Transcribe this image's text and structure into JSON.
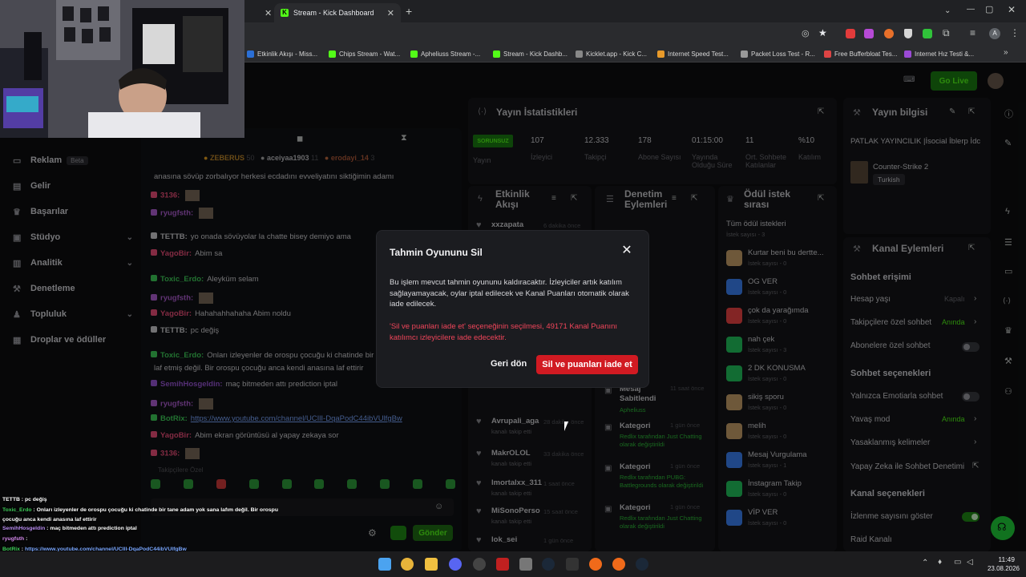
{
  "browser": {
    "active_tab": "Stream - Kick Dashboard",
    "new_tab_icon": "plus-icon",
    "bookmarks": [
      "Etkinlik Akışı - Miss...",
      "Chips Stream - Wat...",
      "Apheliuss Stream -...",
      "Stream - Kick Dashb...",
      "Kicklet.app - Kick C...",
      "Internet Speed Test...",
      "Packet Loss Test - R...",
      "Free Bufferbloat Tes...",
      "Internet Hız Testi &..."
    ]
  },
  "header": {
    "go_live": "Go Live"
  },
  "sidebar": {
    "items": [
      {
        "label": "Reklam",
        "badge": "Beta",
        "icon": "megaphone-icon"
      },
      {
        "label": "Gelir",
        "icon": "money-icon"
      },
      {
        "label": "Başarılar",
        "icon": "trophy-icon"
      },
      {
        "label": "Stüdyo",
        "icon": "studio-icon"
      },
      {
        "label": "Analitik",
        "icon": "chart-icon"
      },
      {
        "label": "Denetleme",
        "icon": "hammer-icon"
      },
      {
        "label": "Topluluk",
        "icon": "people-icon"
      },
      {
        "label": "Droplar ve ödüller",
        "icon": "gift-icon"
      }
    ]
  },
  "chat": {
    "top_users": [
      "ZEBERUS",
      "aceiyaa1903",
      "erodayi_14"
    ],
    "top_counts": [
      "50",
      "11",
      "3"
    ],
    "lines": [
      {
        "user": "",
        "text": "anasına sövüp zorbalıyor herkesi ecdadını evveliyatını siktiğimin adamı",
        "color": "#cfcfd3"
      },
      {
        "user": "3136:",
        "text": "",
        "color": "#ef4f7a"
      },
      {
        "user": "ryugfsth:",
        "text": "",
        "color": "#b15fd6"
      },
      {
        "user": "TETTB:",
        "text": "yo onada sövüyolar la chatte bisey demiyo ama",
        "color": "#cfcfd3"
      },
      {
        "user": "YagoBir:",
        "text": "Abim sa",
        "color": "#ef4f7a"
      },
      {
        "user": "Toxic_Erdo:",
        "text": "Aleyküm selam",
        "color": "#3fcf5a"
      },
      {
        "user": "ryugfsth:",
        "text": "",
        "color": "#b15fd6"
      },
      {
        "user": "YagoBir:",
        "text": "Hahahahhahaha Abim noldu",
        "color": "#ef4f7a"
      },
      {
        "user": "TETTB:",
        "text": "pc değiş",
        "color": "#cfcfd3"
      },
      {
        "user": "Toxic_Erdo:",
        "text": "Onları izleyenler de orospu çocuğu ki chatinde bir tane adam yok sana",
        "color": "#3fcf5a"
      },
      {
        "user": "",
        "text": "laf etmiş değil. Bir orospu çocuğu anca kendi anasına laf ettirir",
        "color": "#cfcfd3"
      },
      {
        "user": "SemihHosgeldin:",
        "text": "maç bitmeden attı prediction iptal",
        "color": "#9a56d8"
      },
      {
        "user": "ryugfsth:",
        "text": "",
        "color": "#b15fd6"
      },
      {
        "user": "BotRix:",
        "text": "https://www.youtube.com/channel/UCIlI-DqaPodC44ibVUlfgBw",
        "color": "#3fcf5a"
      },
      {
        "user": "YagoBir:",
        "text": "Abim ekran görüntüsü al yapay zekaya sor",
        "color": "#ef4f7a"
      },
      {
        "user": "3136:",
        "text": "",
        "color": "#ef4f7a"
      }
    ],
    "followers_only": "Takipçilere Özel",
    "send": "Gönder"
  },
  "stats": {
    "title": "Yayın İstatistikleri",
    "status": "SORUNSUZ",
    "items": [
      {
        "value": "107",
        "label": "İzleyici"
      },
      {
        "value": "12.333",
        "label": "Takipçi"
      },
      {
        "value": "178",
        "label": "Abone Sayısı"
      },
      {
        "value": "01:15:00",
        "label": "Yayında Olduğu Süre"
      },
      {
        "value": "11",
        "label": "Ort. Sohbete Katılanlar"
      },
      {
        "value": "%10",
        "label": "Katılım"
      }
    ],
    "status_label": "Yayın"
  },
  "stream_info": {
    "title": "Yayın bilgisi",
    "stream_title": "PATLAK YAYINCILIK |İsocial İblerp İdc",
    "game": "Counter-Strike 2",
    "language": "Turkish"
  },
  "activity": {
    "title": "Etkinlik Akışı",
    "rows": [
      {
        "user": "xxzapata",
        "sub": "kanalı takip etti",
        "time": "6 dakika önce"
      },
      {
        "user": "Avrupali_aga",
        "sub": "kanalı takip etti",
        "time": "28 dakika önce"
      },
      {
        "user": "MakrOLOL",
        "sub": "kanalı takip etti",
        "time": "33 dakika önce"
      },
      {
        "user": "lmortalxx_311",
        "sub": "kanalı takip etti",
        "time": "1 saat önce"
      },
      {
        "user": "MiSonoPerso",
        "sub": "kanalı takip etti",
        "time": "15 saat önce"
      },
      {
        "user": "lok_sei",
        "sub": "",
        "time": "1 gün önce"
      }
    ]
  },
  "mod_actions": {
    "title": "Denetim Eylemleri",
    "rows": [
      {
        "title": "Mesaj Sabitlendi",
        "by": "Apheliuss",
        "time": "11 saat önce"
      },
      {
        "title": "Kategori",
        "by": "Redlix tarafından Just Chatting olarak değiştirildi",
        "time": "1 gün önce"
      },
      {
        "title": "Kategori",
        "by": "Redlix tarafından PUBG: Battlegrounds olarak değiştirildi",
        "time": "1 gün önce"
      },
      {
        "title": "Kategori",
        "by": "Redlix tarafından Just Chatting olarak değiştirildi",
        "time": "1 gün önce"
      }
    ]
  },
  "rewards": {
    "title": "Ödül istek sırası",
    "all": "Tüm ödül istekleri",
    "all_sub": "İstek sayısı - 3",
    "items": [
      {
        "name": "Kurtar beni bu dertte...",
        "sub": "İstek sayısı - 0",
        "color": "#c8a06a"
      },
      {
        "name": "OG VER",
        "sub": "İstek sayısı - 0",
        "color": "#3b82f6"
      },
      {
        "name": "çok da yarağımda",
        "sub": "İstek sayısı - 0",
        "color": "#ef4444"
      },
      {
        "name": "nah çek",
        "sub": "İstek sayısı - 3",
        "color": "#22c55e"
      },
      {
        "name": "2 DK KONUSMA",
        "sub": "İstek sayısı - 0",
        "color": "#22c55e"
      },
      {
        "name": "sikiş sporu",
        "sub": "İstek sayısı - 0",
        "color": "#c8a06a"
      },
      {
        "name": "melih",
        "sub": "İstek sayısı - 0",
        "color": "#c8a06a"
      },
      {
        "name": "Mesaj Vurgulama",
        "sub": "İstek sayısı - 1",
        "color": "#3b82f6"
      },
      {
        "name": "İnstagram Takip",
        "sub": "İstek sayısı - 0",
        "color": "#22c55e"
      },
      {
        "name": "VİP VER",
        "sub": "İstek sayısı - 0",
        "color": "#3b82f6"
      }
    ]
  },
  "channel_actions": {
    "title": "Kanal Eylemleri",
    "chat_access": "Sohbet erişimi",
    "age": "Hesap yaşı",
    "age_val": "Kapalı",
    "followers_only": "Takipçilere özel sohbet",
    "followers_val": "Anında",
    "subs_only": "Abonelere özel sohbet",
    "chat_options": "Sohbet seçenekleri",
    "emotes_only": "Yalnızca Emotiarla sohbet",
    "slow_mode": "Yavaş mod",
    "slow_val": "Anında",
    "banned_words": "Yasaklanmış kelimeler",
    "ai_mod": "Yapay Zeka ile Sohbet Denetimi",
    "channel_options": "Kanal seçenekleri",
    "show_views": "İzlenme sayısını göster",
    "raid": "Raid Kanalı"
  },
  "modal": {
    "title": "Tahmin Oyununu Sil",
    "body": "Bu işlem mevcut tahmin oyununu kaldıracaktır. İzleyiciler artık katılım sağlayamayacak, oylar iptal edilecek ve Kanal Puanları otomatik olarak iade edilecek.",
    "warning": "'Sil ve puanları iade et' seçeneğinin seçilmesi, 49171 Kanal Puanını katılımcı izleyicilere iade edecektir.",
    "back": "Geri dön",
    "confirm": "Sil ve puanları iade et"
  },
  "overlay_chat": [
    {
      "user": "TETTB",
      "text": "pc değiş",
      "color": "#ffffff"
    },
    {
      "user": "Toxic_Erdo",
      "text": "Onları izleyenler de orospu çocuğu ki chatinde bir tane adam yok sana lafım değil. Bir orospu",
      "color": "#3fcf5a"
    },
    {
      "user": "",
      "text": "çocuğu anca kendi anasına laf ettirir",
      "color": "#ffffff"
    },
    {
      "user": "SemihHosgeldin",
      "text": "maç bitmeden attı prediction iptal",
      "color": "#b88cf0"
    },
    {
      "user": "ryugfsth",
      "text": "",
      "color": "#d88cf0"
    },
    {
      "user": "BotRix",
      "text": "https://www.youtube.com/channel/UCIlI-DqaPodC44ibVUlfgBw",
      "color": "#3fcf5a"
    },
    {
      "user": "YagoBir",
      "text": "Abim ekran görüntüsü al yapay zekaya sor",
      "color": "#ef4f7a"
    },
    {
      "user": "3136",
      "text": "",
      "color": "#ef4f7a"
    }
  ],
  "taskbar": {
    "time": "11:49",
    "date": "23.08.2026"
  }
}
